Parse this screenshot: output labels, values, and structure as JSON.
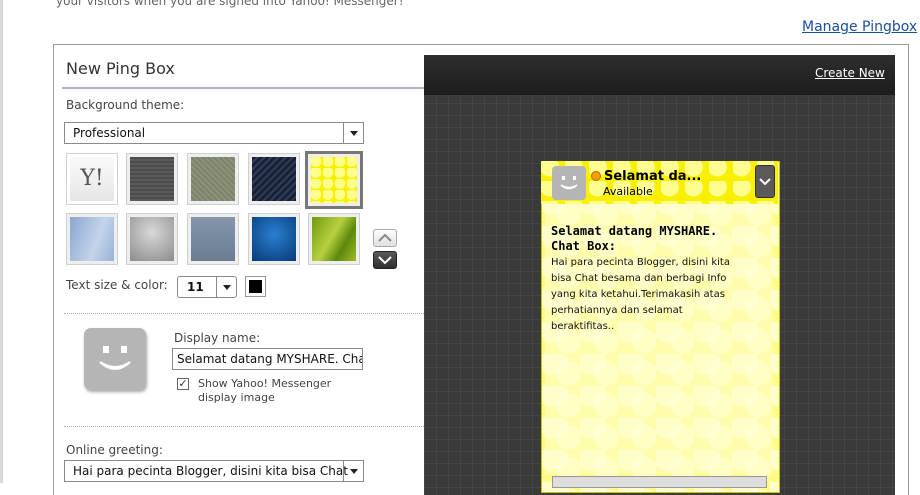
{
  "page": {
    "top_text": "your visitors when you are signed into Yahoo! Messenger!",
    "manage_link": "Manage Pingbox"
  },
  "editor": {
    "title": "New Ping Box",
    "background_theme_label": "Background theme:",
    "theme_select_value": "Professional",
    "yahoo_swatch_text": "Y!",
    "text_size_color_label": "Text size & color:",
    "text_size_value": "11",
    "text_color": "#000000",
    "display_name_label": "Display name:",
    "display_name_value": "Selamat datang MYSHARE. Chat",
    "show_image_label_line1": "Show Yahoo! Messenger",
    "show_image_label_line2": "display image",
    "show_image_checked": "✓",
    "online_greeting_label": "Online greeting:",
    "online_greeting_value": "Hai para pecinta Blogger, disini kita bisa Chat"
  },
  "preview": {
    "create_new_link": "Create New",
    "name": "Selamat da...",
    "status": "Available",
    "title_line1": "Selamat datang MYSHARE.",
    "title_line2": "Chat Box:",
    "greeting": "Hai para pecinta Blogger, disini kita bisa Chat besama dan berbagi Info yang kita ketahui.Terimakasih atas perhatiannya dan selamat beraktifitas.."
  },
  "colors": {
    "link": "#1a4f9c",
    "selected_theme": "#f8f000",
    "preview_bg": "#3a3a3a"
  }
}
